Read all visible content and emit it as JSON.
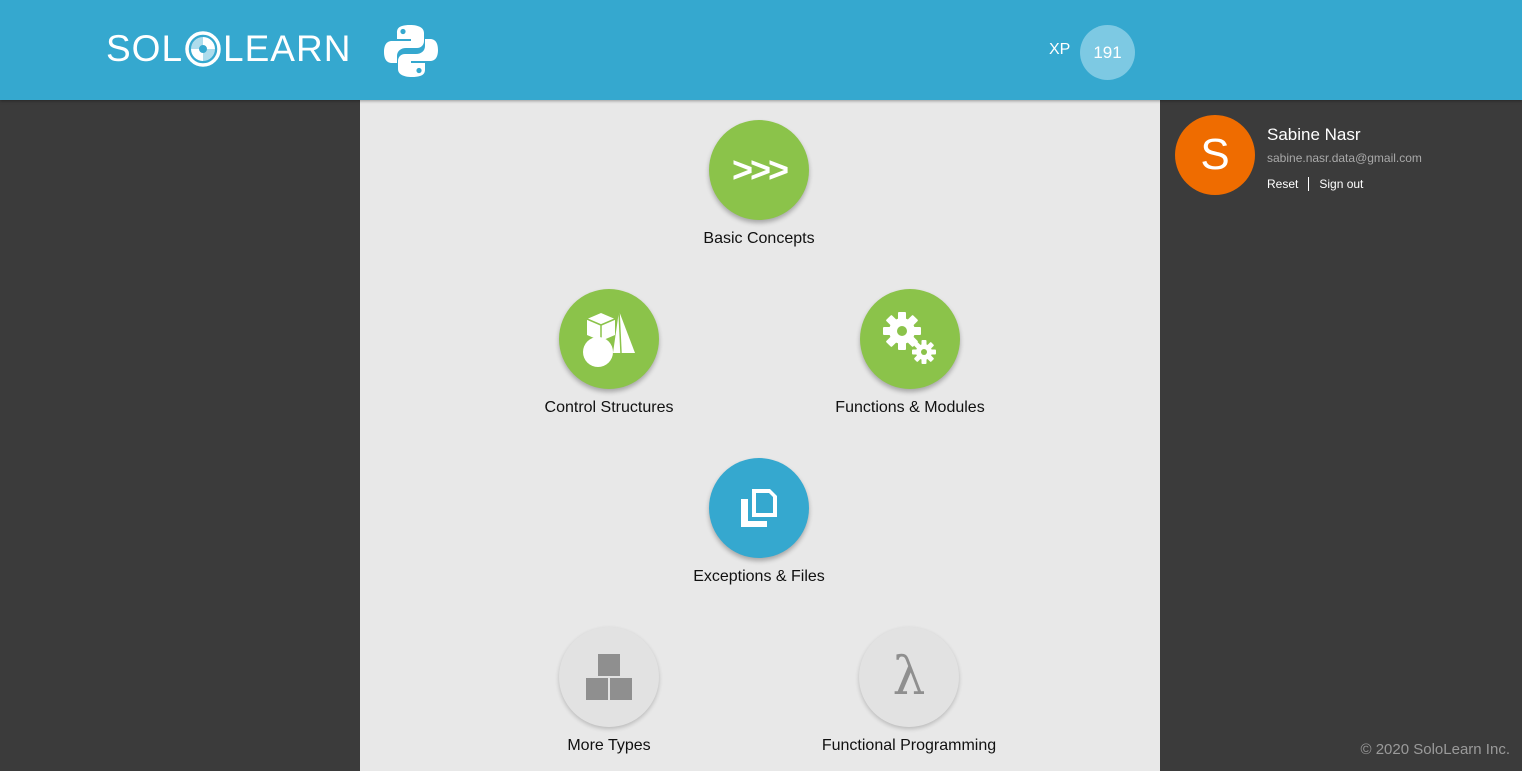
{
  "header": {
    "logo_left": "SOL",
    "logo_right": "LEARN",
    "course_icon": "python-logo-icon",
    "xp_label": "XP",
    "xp_value": "191"
  },
  "courses": [
    {
      "label": "Basic Concepts",
      "icon": "prompt-chevrons-icon",
      "state": "completed",
      "color": "#8bc34a",
      "icon_text": ">>>"
    },
    {
      "label": "Control Structures",
      "icon": "shapes-icon",
      "state": "completed",
      "color": "#8bc34a"
    },
    {
      "label": "Functions & Modules",
      "icon": "gears-icon",
      "state": "completed",
      "color": "#8bc34a"
    },
    {
      "label": "Exceptions & Files",
      "icon": "files-icon",
      "state": "current",
      "color": "#35a8cf"
    },
    {
      "label": "More Types",
      "icon": "blocks-icon",
      "state": "locked",
      "color": "#e2e2e2"
    },
    {
      "label": "Functional Programming",
      "icon": "lambda-icon",
      "state": "locked",
      "color": "#e2e2e2",
      "icon_text": "λ"
    }
  ],
  "profile": {
    "avatar_letter": "S",
    "avatar_color": "#ef6c00",
    "name": "Sabine Nasr",
    "email": "sabine.nasr.data@gmail.com",
    "reset_label": "Reset",
    "signout_label": "Sign out"
  },
  "footer": {
    "copyright": "© 2020 SoloLearn Inc."
  },
  "colors": {
    "header": "#35a8cf",
    "completed": "#8bc34a",
    "current": "#35a8cf",
    "locked": "#e2e2e2",
    "sidebar_bg": "#3b3b3b",
    "content_bg": "#e8e8e8"
  }
}
